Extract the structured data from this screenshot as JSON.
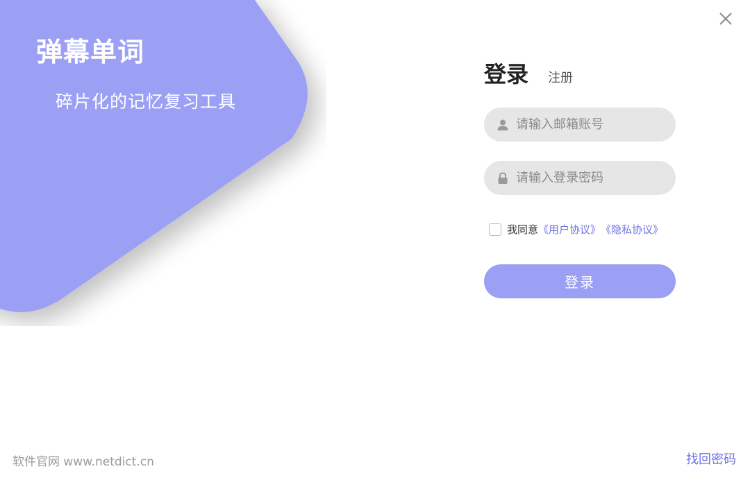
{
  "brand": {
    "title": "弹幕单词",
    "subtitle": "碎片化的记忆复习工具",
    "accent_color": "#9ba0f5",
    "link_color": "#6f73e0"
  },
  "window": {
    "close_icon": "close-icon"
  },
  "tabs": {
    "login_label": "登录",
    "register_label": "注册"
  },
  "form": {
    "email": {
      "placeholder": "请输入邮箱账号",
      "value": "",
      "icon": "user-icon"
    },
    "password": {
      "placeholder": "请输入登录密码",
      "value": "",
      "icon": "lock-icon"
    },
    "agreement": {
      "checked": false,
      "prefix": "我同意",
      "user_agreement": "《用户协议》",
      "privacy_policy": "《隐私协议》"
    },
    "submit_label": "登录"
  },
  "footer": {
    "site_text": "软件官网 www.netdict.cn",
    "recover_label": "找回密码"
  }
}
